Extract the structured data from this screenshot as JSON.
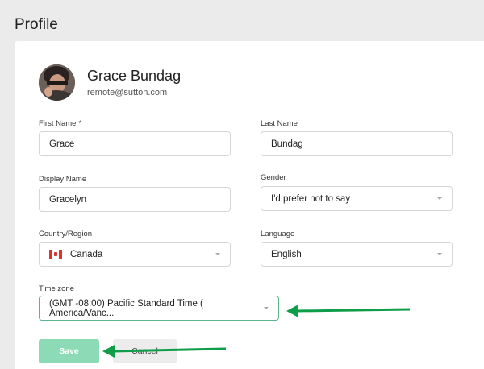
{
  "page": {
    "title": "Profile"
  },
  "user": {
    "name": "Grace Bundag",
    "email": "remote@sutton.com"
  },
  "form": {
    "first_name": {
      "label": "First Name",
      "required_mark": "*",
      "value": "Grace"
    },
    "last_name": {
      "label": "Last Name",
      "value": "Bundag"
    },
    "display_name": {
      "label": "Display Name",
      "value": "Gracelyn"
    },
    "gender": {
      "label": "Gender",
      "value": "I'd prefer not to say"
    },
    "country": {
      "label": "Country/Region",
      "value": "Canada",
      "flag_icon": "canada-flag-icon"
    },
    "language": {
      "label": "Language",
      "value": "English"
    },
    "timezone": {
      "label": "Time zone",
      "value": "(GMT -08:00) Pacific Standard Time ( America/Vanc..."
    }
  },
  "actions": {
    "save_label": "Save",
    "cancel_label": "Cancel"
  },
  "colors": {
    "accent": "#5ab58c",
    "save_button": "#8cdbb6",
    "annotation_arrow": "#0f9d4a",
    "canada_red": "#e0312d"
  }
}
